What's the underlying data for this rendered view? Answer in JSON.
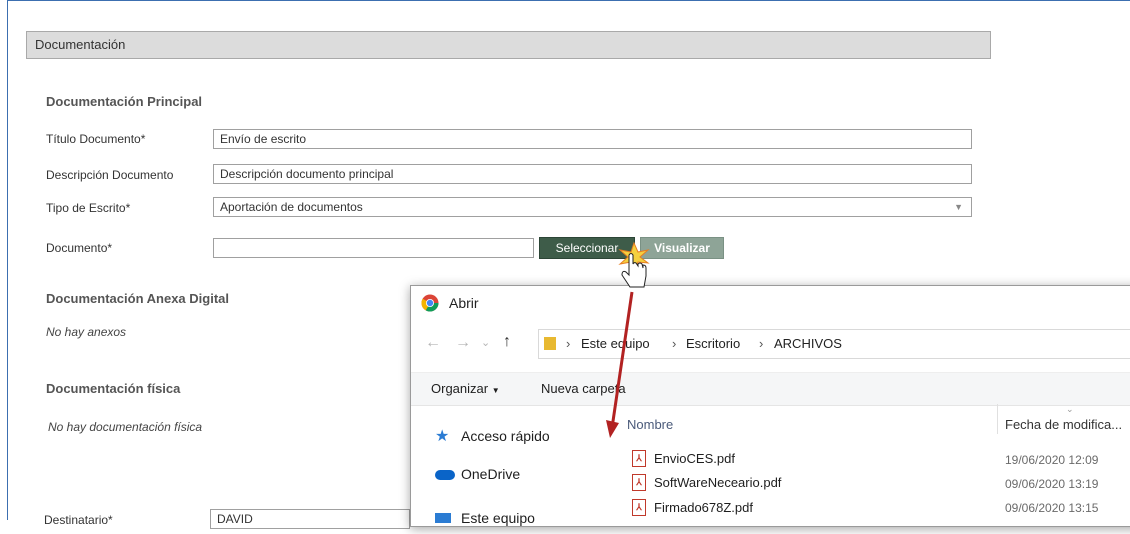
{
  "section": {
    "title": "Documentación"
  },
  "principal": {
    "title": "Documentación Principal",
    "titulo_label": "Título Documento*",
    "titulo_value": "Envío de escrito",
    "descripcion_label": "Descripción Documento",
    "descripcion_value": "Descripción documento principal",
    "tipo_label": "Tipo de Escrito*",
    "tipo_value": "Aportación de documentos",
    "documento_label": "Documento*",
    "documento_value": "",
    "seleccionar_label": "Seleccionar",
    "visualizar_label": "Visualizar"
  },
  "anexa": {
    "title": "Documentación Anexa Digital",
    "empty": "No hay anexos"
  },
  "fisica": {
    "title": "Documentación física",
    "empty": "No hay documentación física"
  },
  "destinatario": {
    "label": "Destinatario*",
    "value": "DAVID"
  },
  "dialog": {
    "title": "Abrir",
    "breadcrumb": [
      "Este equipo",
      "Escritorio",
      "ARCHIVOS"
    ],
    "toolbar": {
      "organizar": "Organizar",
      "nueva_carpeta": "Nueva carpeta"
    },
    "nav": [
      "Acceso rápido",
      "OneDrive",
      "Este equipo"
    ],
    "columns": {
      "nombre": "Nombre",
      "fecha": "Fecha de modifica..."
    },
    "files": [
      {
        "name": "EnvioCES.pdf",
        "date": "19/06/2020 12:09"
      },
      {
        "name": "SoftWareNeceario.pdf",
        "date": "09/06/2020 13:19"
      },
      {
        "name": "Firmado678Z.pdf",
        "date": "09/06/2020 13:15"
      }
    ],
    "icons": {
      "back": "back-arrow-icon",
      "forward": "forward-arrow-icon",
      "up": "up-arrow-icon"
    }
  },
  "colors": {
    "button_dark": "#3e5c49",
    "button_light": "#8ea497",
    "arrow": "#b22222",
    "pdf": "#c0392b"
  }
}
